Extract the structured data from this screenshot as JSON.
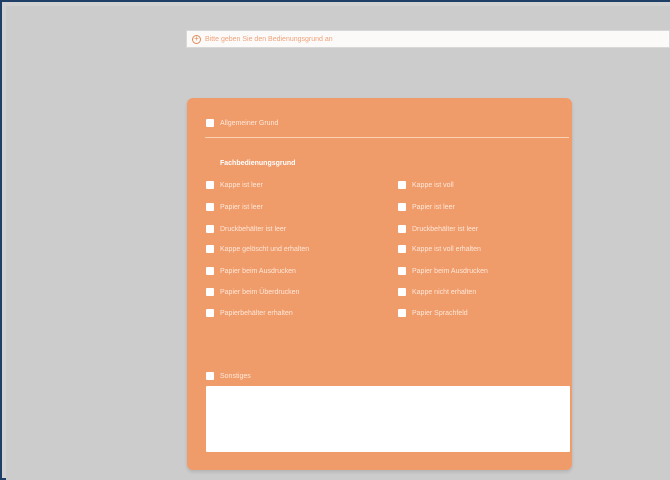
{
  "instruction": {
    "icon": "circle-plus-icon",
    "text": "Bitte geben Sie den Bedienungsgrund an"
  },
  "panel": {
    "top_option": {
      "label": "Allgemeiner Grund"
    },
    "group_title": "Fachbedienungsgrund",
    "left_options": [
      {
        "label": "Kappe ist leer"
      },
      {
        "label": "Papier ist leer"
      },
      {
        "label": "Druckbehälter ist leer"
      },
      {
        "label": "Kappe gelöscht und erhalten"
      },
      {
        "label": "Papier beim Ausdrucken"
      },
      {
        "label": "Papier beim Überdrucken"
      },
      {
        "label": "Papierbehälter erhalten"
      }
    ],
    "right_options": [
      {
        "label": "Kappe ist voll"
      },
      {
        "label": "Papier ist leer"
      },
      {
        "label": "Druckbehälter ist leer"
      },
      {
        "label": "Kappe ist voll erhalten"
      },
      {
        "label": "Papier beim Ausdrucken"
      },
      {
        "label": "Kappe nicht erhalten"
      },
      {
        "label": "Papier Sprachfeld"
      }
    ],
    "notes_option": {
      "label": "Sonstiges"
    },
    "notes_value": ""
  },
  "colors": {
    "panel": "#f09b6a",
    "background": "#cccccc",
    "frame": "#1f3f66"
  }
}
